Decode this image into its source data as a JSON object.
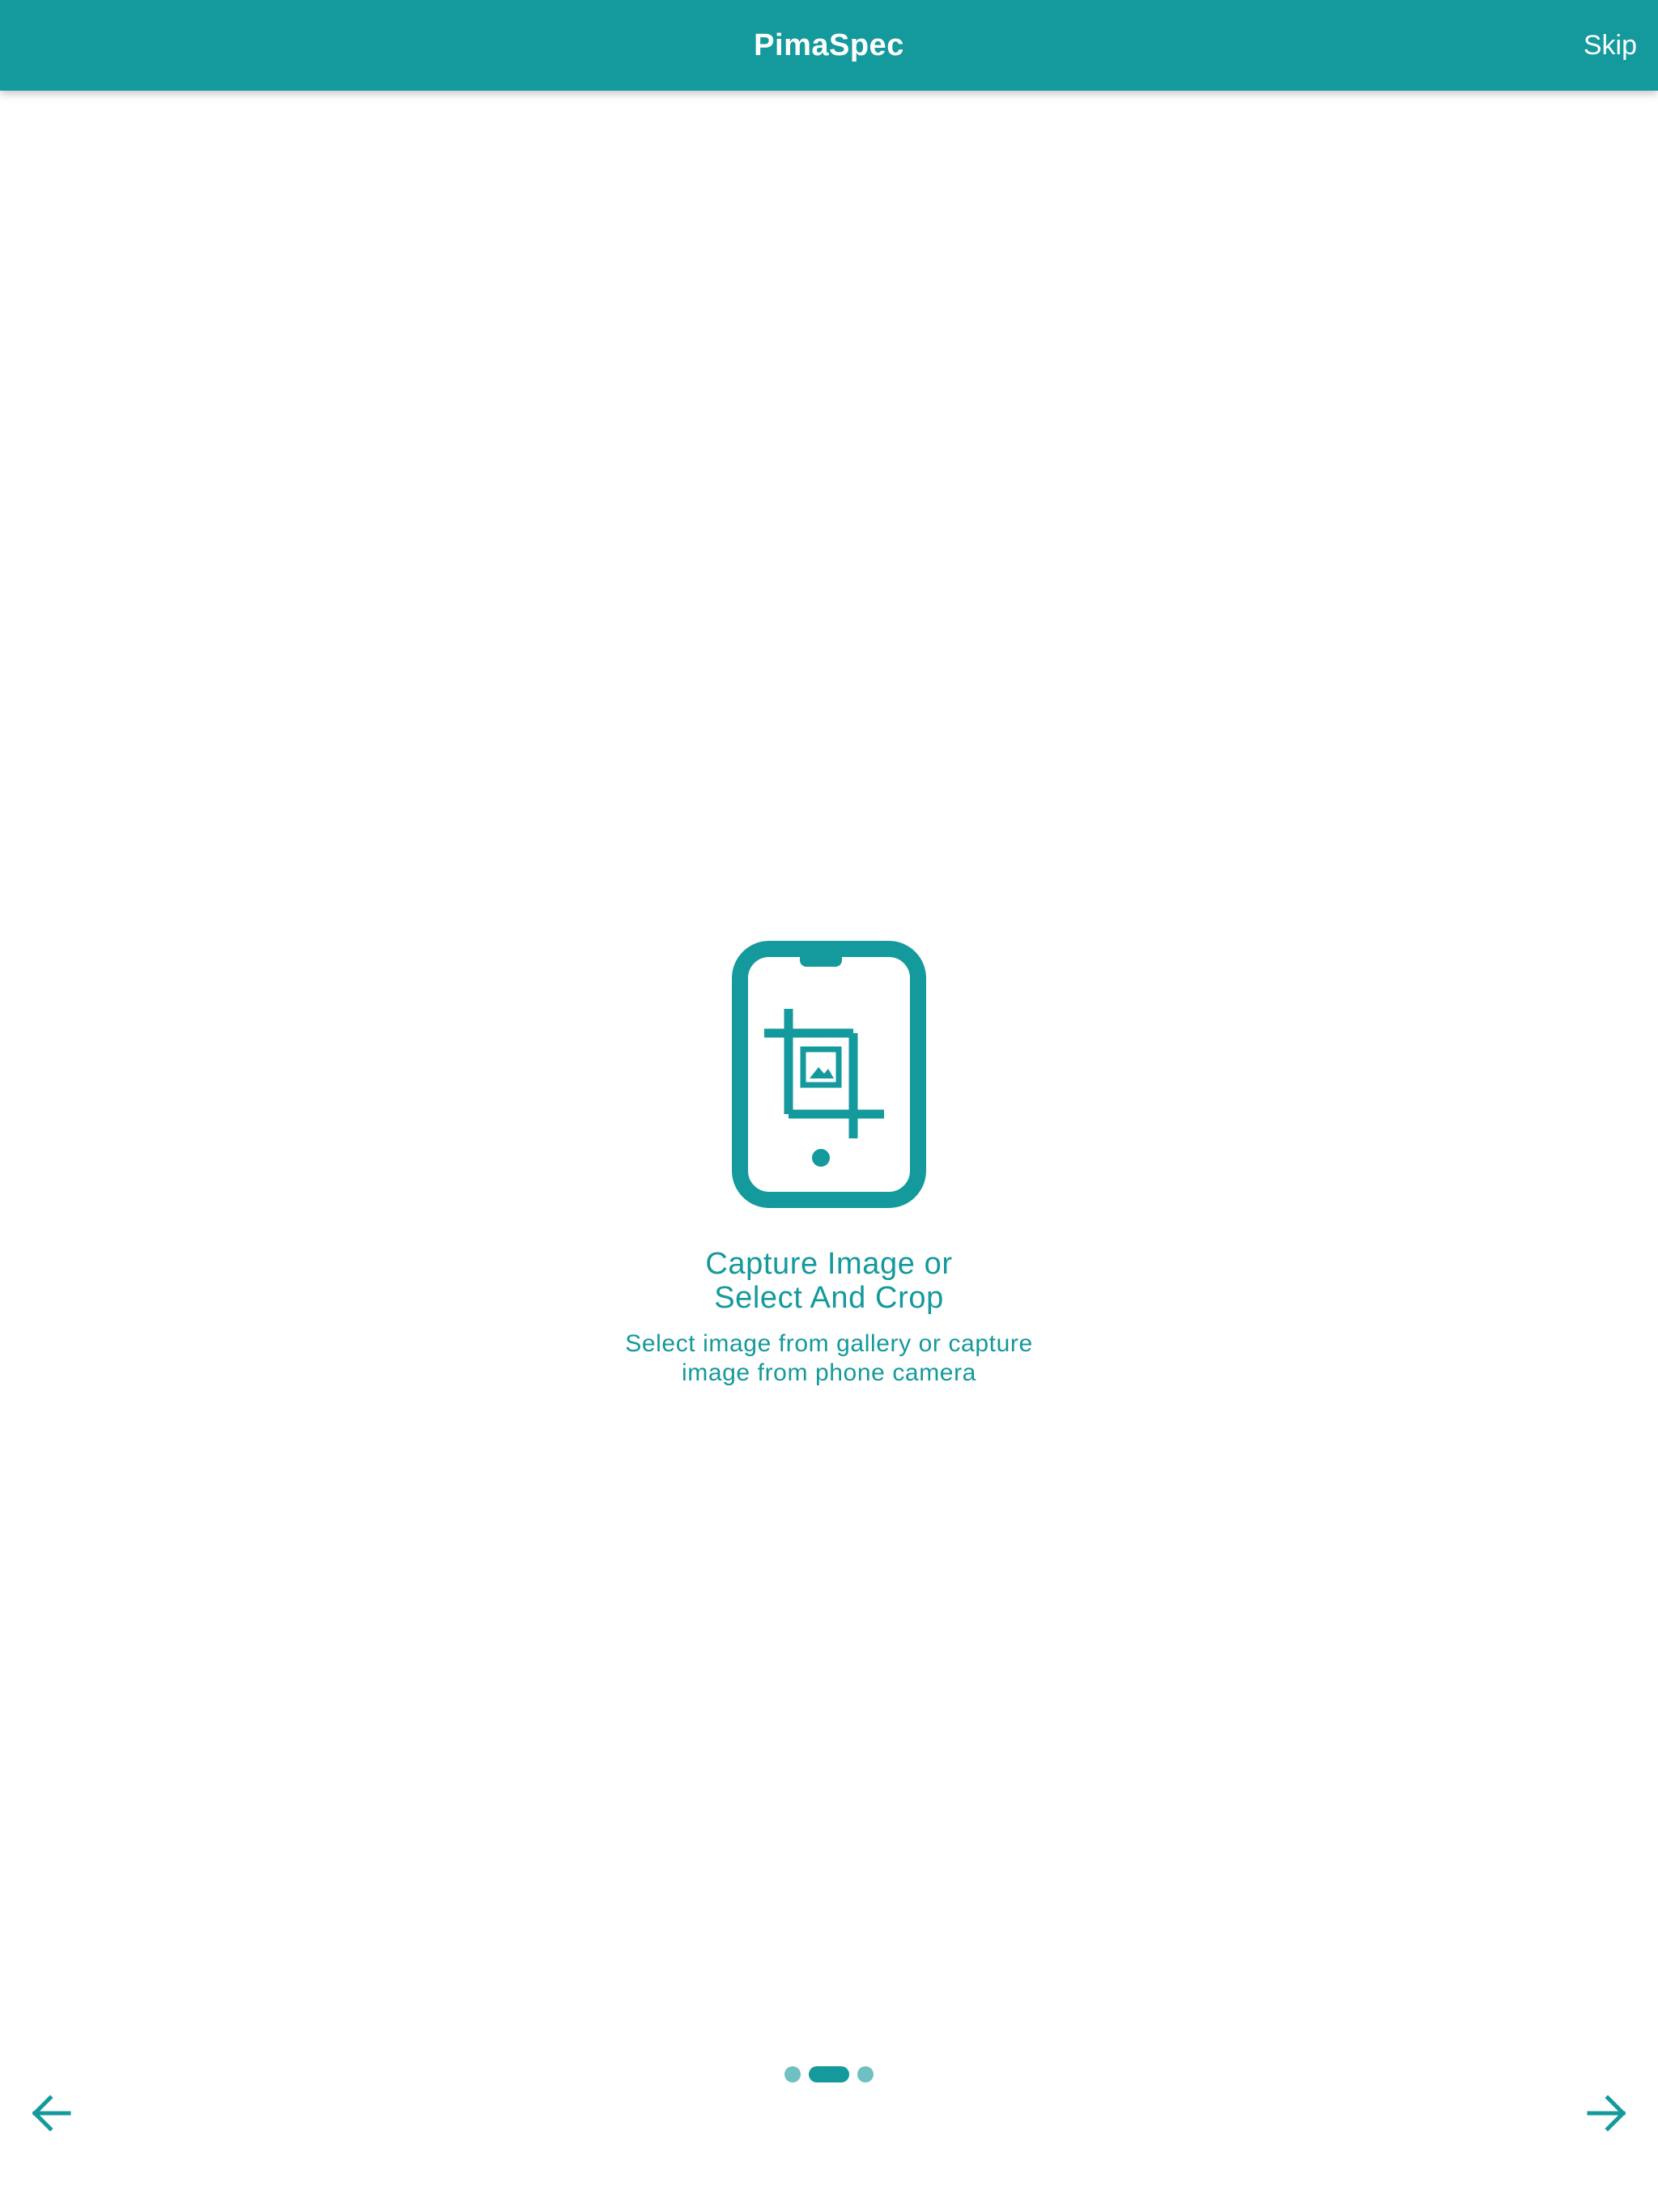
{
  "appbar": {
    "title": "PimaSpec",
    "skip_label": "Skip"
  },
  "onboarding": {
    "icon": "phone-crop-image-icon",
    "title_lines": [
      "Capture Image or",
      "Select And Crop"
    ],
    "subtitle_lines": [
      "Select image from gallery or capture",
      "image from phone camera"
    ]
  },
  "pager": {
    "pages": 3,
    "current_page": 2
  },
  "navigation": {
    "back_icon": "arrow-left-icon",
    "next_icon": "arrow-right-icon"
  },
  "colors": {
    "primary": "#14999c",
    "dot_inactive": "#6fc0c2",
    "background": "#ffffff"
  }
}
